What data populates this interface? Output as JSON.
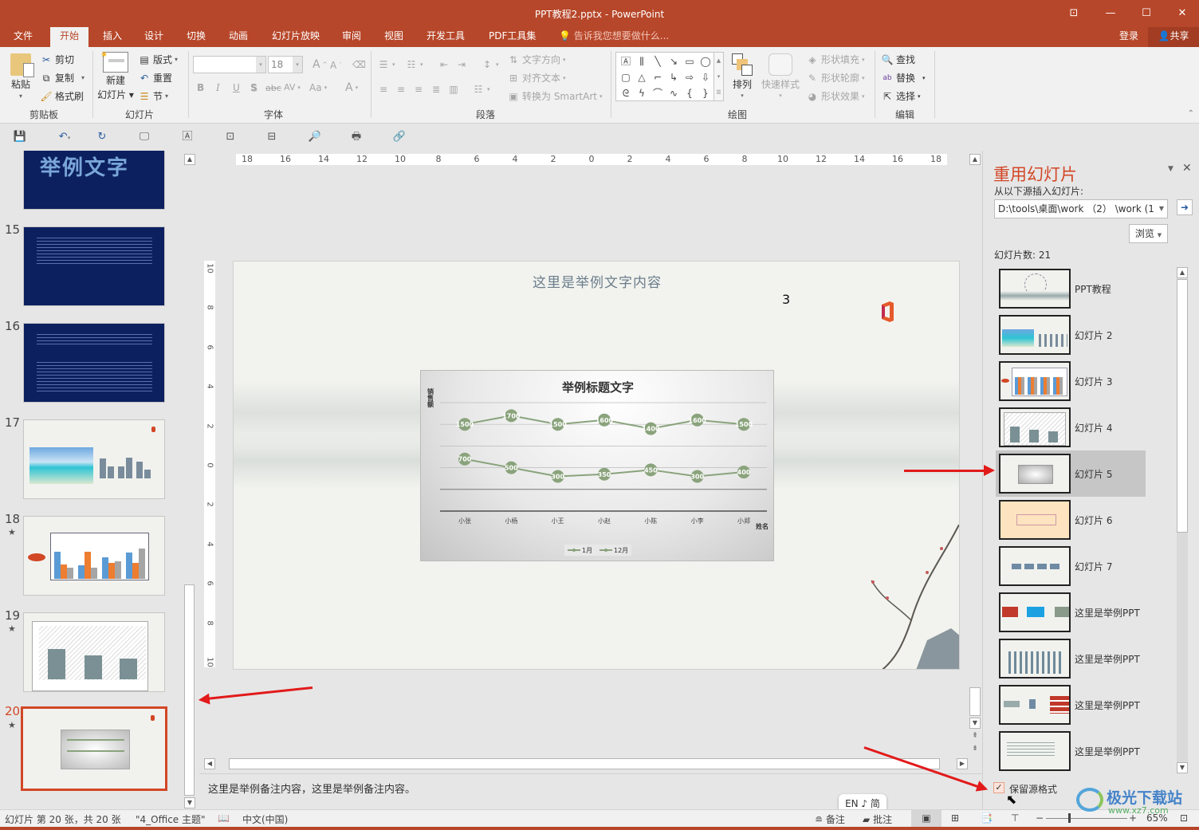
{
  "window": {
    "title": "PPT教程2.pptx - PowerPoint",
    "controls": {
      "restore_ribbon": "⊡",
      "minimize": "—",
      "maximize": "☐",
      "close": "✕"
    }
  },
  "tabs": [
    {
      "label": "文件"
    },
    {
      "label": "开始",
      "active": true
    },
    {
      "label": "插入"
    },
    {
      "label": "设计"
    },
    {
      "label": "切换"
    },
    {
      "label": "动画"
    },
    {
      "label": "幻灯片放映"
    },
    {
      "label": "审阅"
    },
    {
      "label": "视图"
    },
    {
      "label": "开发工具"
    },
    {
      "label": "PDF工具集"
    }
  ],
  "tell_me": "告诉我您想要做什么...",
  "login": "登录",
  "share": "共享",
  "ribbon": {
    "clipboard": {
      "paste": "粘贴",
      "cut": "剪切",
      "copy": "复制",
      "format_painter": "格式刷",
      "label": "剪贴板"
    },
    "slides": {
      "new_slide_1": "新建",
      "new_slide_2": "幻灯片",
      "layout": "版式",
      "reset": "重置",
      "section": "节",
      "label": "幻灯片"
    },
    "font": {
      "font_name": "",
      "font_size": "18",
      "bold": "B",
      "italic": "I",
      "underline": "U",
      "shadow": "S",
      "strike": "abc",
      "spacing": "AV",
      "case": "Aa",
      "color": "A",
      "grow": "A",
      "shrink": "A",
      "label": "字体"
    },
    "paragraph": {
      "text_direction": "文字方向",
      "align_text": "对齐文本",
      "smartart": "转换为 SmartArt",
      "label": "段落"
    },
    "drawing": {
      "arrange": "排列",
      "quick_styles": "快速样式",
      "shape_fill": "形状填充",
      "shape_outline": "形状轮廓",
      "shape_effects": "形状效果",
      "label": "绘图"
    },
    "editing": {
      "find": "查找",
      "replace": "替换",
      "select": "选择",
      "label": "编辑"
    }
  },
  "slide_panel": {
    "top_thumb_text": "举例文字",
    "slides": [
      {
        "num": "15",
        "star": false,
        "theme": "dark"
      },
      {
        "num": "16",
        "star": false,
        "theme": "dark"
      },
      {
        "num": "17",
        "star": false,
        "theme": "light"
      },
      {
        "num": "18",
        "star": true,
        "theme": "light"
      },
      {
        "num": "19",
        "star": true,
        "theme": "light"
      },
      {
        "num": "20",
        "star": true,
        "theme": "light",
        "selected": true
      }
    ],
    "star_glyph": "★"
  },
  "ruler": {
    "h_labels": [
      "18",
      "16",
      "14",
      "12",
      "10",
      "8",
      "6",
      "4",
      "2",
      "0",
      "2",
      "4",
      "6",
      "8",
      "10",
      "12",
      "14",
      "16",
      "18"
    ],
    "v_labels": [
      "10",
      "8",
      "6",
      "4",
      "2",
      "0",
      "2",
      "4",
      "6",
      "8",
      "10"
    ]
  },
  "slide": {
    "title": "这里是举例文字内容",
    "number_text": "3"
  },
  "chart_data": {
    "type": "line",
    "title": "举例标题文字",
    "ylabel": "销售额",
    "xlabel": "姓名",
    "categories": [
      "小张",
      "小杨",
      "小王",
      "小赵",
      "小陈",
      "小李",
      "小郑"
    ],
    "series": [
      {
        "name": "1月",
        "values": [
          700,
          500,
          300,
          350,
          450,
          300,
          400
        ]
      },
      {
        "name": "12月",
        "values": [
          1500,
          1700,
          1500,
          1600,
          1400,
          1600,
          1500
        ]
      }
    ],
    "ylim": [
      -500,
      2000
    ],
    "grid": true,
    "legend": "bottom",
    "line_color": "#8aa37c"
  },
  "notes": "这里是举例备注内容，这里是举例备注内容。",
  "reuse_pane": {
    "title": "重用幻灯片",
    "insert_from": "从以下源插入幻灯片:",
    "source_path": "D:\\tools\\桌面\\work （2） \\work (1",
    "browse": "浏览",
    "count_label": "幻灯片数: 21",
    "items": [
      {
        "label": "PPT教程"
      },
      {
        "label": "幻灯片 2"
      },
      {
        "label": "幻灯片 3"
      },
      {
        "label": "幻灯片 4"
      },
      {
        "label": "幻灯片 5",
        "selected": true
      },
      {
        "label": "幻灯片 6"
      },
      {
        "label": "幻灯片 7"
      },
      {
        "label": "这里是举例PPT"
      },
      {
        "label": "这里是举例PPT"
      },
      {
        "label": "这里是举例PPT"
      },
      {
        "label": "这里是举例PPT"
      }
    ],
    "keep_format": "保留源格式",
    "keep_format_checked": true
  },
  "ime": "EN ♪ 简",
  "status": {
    "slide_info": "幻灯片 第 20 张，共 20 张",
    "theme": "\"4_Office 主题\"",
    "language": "中文(中国)",
    "notes_btn": "备注",
    "comments_btn": "批注",
    "zoom": "65%"
  },
  "watermark": {
    "name": "极光下载站",
    "url": "www.xz7.com"
  }
}
